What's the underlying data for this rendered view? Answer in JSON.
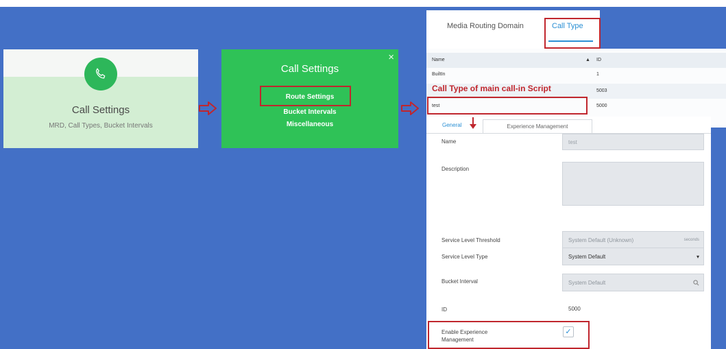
{
  "tile1": {
    "title": "Call Settings",
    "subtitle": "MRD, Call Types, Bucket Intervals",
    "icon": "phone-icon"
  },
  "tile2": {
    "title": "Call Settings",
    "close": "×",
    "menu": {
      "route": "Route Settings",
      "bucket": "Bucket Intervals",
      "misc": "Miscellaneous"
    }
  },
  "tabs": {
    "mrd": "Media Routing Domain",
    "call_type": "Call Type"
  },
  "grid": {
    "headers": {
      "name": "Name",
      "id": "ID",
      "sort": "▲"
    },
    "rows": [
      {
        "name": "BuiltIn",
        "id": "1"
      },
      {
        "name": "",
        "id": "5003"
      },
      {
        "name": "test",
        "id": "5000"
      }
    ]
  },
  "annotation": "Call Type of main call-in Script",
  "form": {
    "tabs": {
      "general": "General",
      "experience": "Experience Management"
    },
    "labels": {
      "name": "Name",
      "description": "Description",
      "sl_threshold": "Service Level Threshold",
      "sl_type": "Service Level Type",
      "bucket": "Bucket Interval",
      "id": "ID",
      "enable": "Enable Experience Management"
    },
    "values": {
      "name": "test",
      "sl_threshold": "System Default (Unknown)",
      "sl_threshold_unit": "seconds",
      "sl_type": "System Default",
      "bucket": "System Default",
      "id": "5000",
      "check": "✓"
    }
  },
  "colors": {
    "background": "#4370c6",
    "tile_green": "#2fc257",
    "highlight_red": "#c0262d",
    "accent_blue": "#2a8fd4"
  }
}
